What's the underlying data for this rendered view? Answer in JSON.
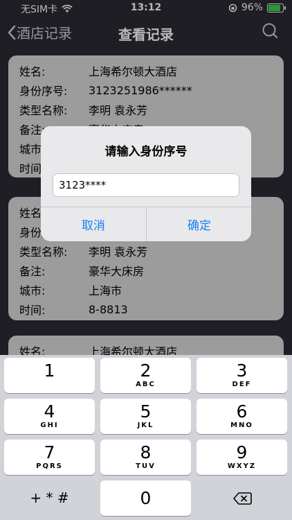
{
  "status_bar": {
    "carrier": "无SIM卡",
    "time": "13:12",
    "battery": "96%",
    "battery_level": 0.96
  },
  "nav": {
    "back_label": "酒店记录",
    "title": "查看记录"
  },
  "labels": {
    "name": "姓名:",
    "id": "身份序号:",
    "type": "类型名称:",
    "note": "备注:",
    "city": "城市:",
    "time": "时间:"
  },
  "records": [
    {
      "name": "上海希尔顿大酒店",
      "id": "3123251986******",
      "type": "李明 袁永芳",
      "note": "豪华大床房"
    },
    {
      "type": "李明 袁永芳",
      "note": "豪华大床房",
      "city": "上海市",
      "time": "8-8813"
    },
    {
      "name": "上海希尔顿大酒店"
    }
  ],
  "alert": {
    "title": "请输入身份序号",
    "input_value": "3123****",
    "cancel_label": "取消",
    "confirm_label": "确定"
  },
  "keyboard": {
    "keys": [
      {
        "num": "1",
        "letters": ""
      },
      {
        "num": "2",
        "letters": "ABC"
      },
      {
        "num": "3",
        "letters": "DEF"
      },
      {
        "num": "4",
        "letters": "GHI"
      },
      {
        "num": "5",
        "letters": "JKL"
      },
      {
        "num": "6",
        "letters": "MNO"
      },
      {
        "num": "7",
        "letters": "PQRS"
      },
      {
        "num": "8",
        "letters": "TUV"
      },
      {
        "num": "9",
        "letters": "WXYZ"
      }
    ],
    "symbols_label": "+ * #",
    "zero": "0"
  }
}
